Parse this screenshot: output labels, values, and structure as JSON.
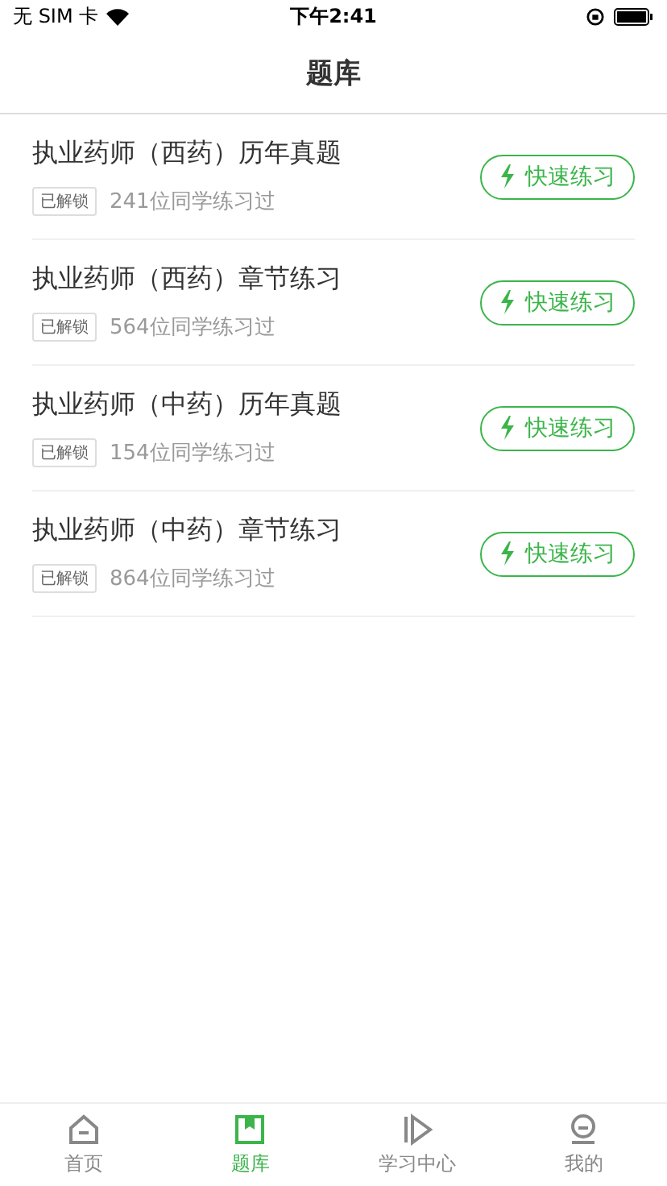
{
  "status_bar": {
    "carrier": "无 SIM 卡",
    "time": "下午2:41"
  },
  "header": {
    "title": "题库"
  },
  "items": [
    {
      "title": "执业药师（西药）历年真题",
      "badge": "已解锁",
      "count": "241位同学练习过",
      "action": "快速练习"
    },
    {
      "title": "执业药师（西药）章节练习",
      "badge": "已解锁",
      "count": "564位同学练习过",
      "action": "快速练习"
    },
    {
      "title": "执业药师（中药）历年真题",
      "badge": "已解锁",
      "count": "154位同学练习过",
      "action": "快速练习"
    },
    {
      "title": "执业药师（中药）章节练习",
      "badge": "已解锁",
      "count": "864位同学练习过",
      "action": "快速练习"
    }
  ],
  "tab_bar": [
    {
      "kind": "home",
      "label": "首页",
      "selected": false
    },
    {
      "kind": "bank",
      "label": "题库",
      "selected": true
    },
    {
      "kind": "play",
      "label": "学习中心",
      "selected": false
    },
    {
      "kind": "user",
      "label": "我的",
      "selected": false
    }
  ]
}
